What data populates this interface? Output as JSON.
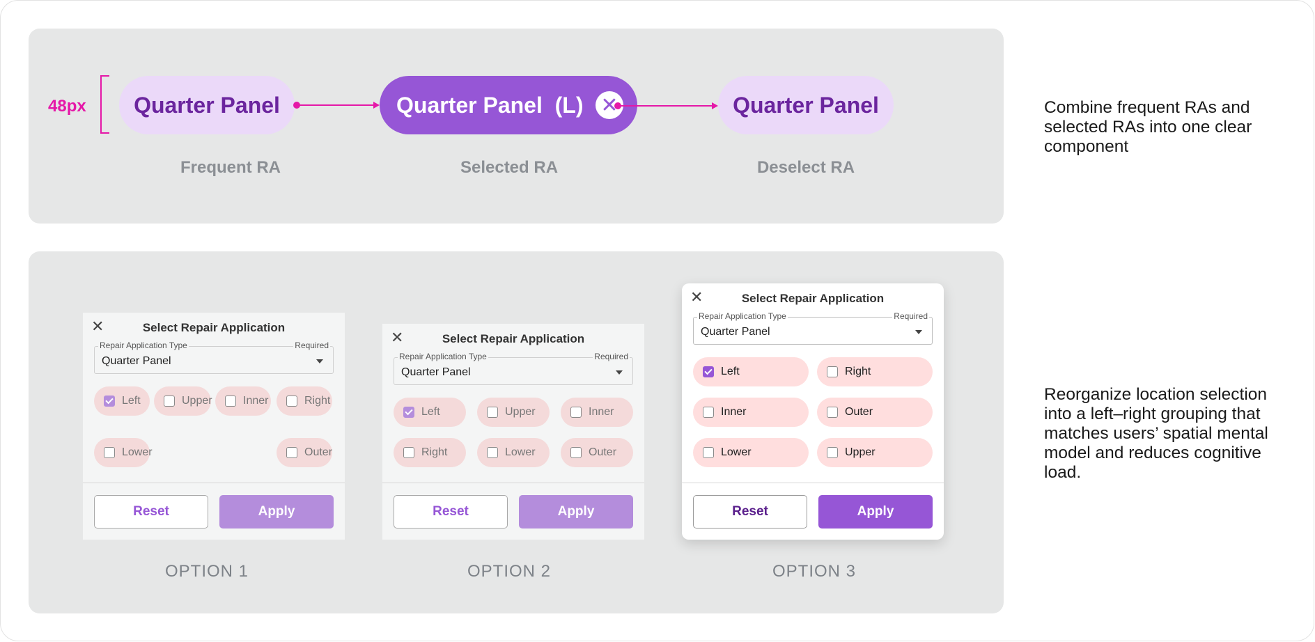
{
  "flow": {
    "height_marker": "48px",
    "chips": [
      {
        "label": "Quarter Panel",
        "caption": "Frequent RA"
      },
      {
        "label": "Quarter Panel  (L)",
        "caption": "Selected RA",
        "close_glyph": "✕"
      },
      {
        "label": "Quarter Panel",
        "caption": "Deselect RA"
      }
    ],
    "accent_color": "#e518a8",
    "chip_selected_color": "#9656d6",
    "chip_frequent_color": "#ebd9f9"
  },
  "notes": {
    "top": "Combine frequent RAs and selected RAs into one clear component",
    "bottom": "Reorganize location selection into a left–right grouping that matches users’ spatial mental model and reduces cognitive load."
  },
  "dialogs": [
    {
      "option_label": "OPTION 1",
      "title": "Select Repair Application",
      "field_label": "Repair Application Type",
      "field_required": "Required",
      "field_value": "Quarter Panel",
      "options": [
        {
          "label": "Left",
          "checked": true
        },
        {
          "label": "Upper",
          "checked": false
        },
        {
          "label": "Inner",
          "checked": false
        },
        {
          "label": "Right",
          "checked": false
        },
        {
          "label": "Lower",
          "checked": false
        },
        {
          "label": "Outer",
          "checked": false
        }
      ],
      "reset_label": "Reset",
      "apply_label": "Apply"
    },
    {
      "option_label": "OPTION 2",
      "title": "Select Repair Application",
      "field_label": "Repair Application Type",
      "field_required": "Required",
      "field_value": "Quarter Panel",
      "options": [
        {
          "label": "Left",
          "checked": true
        },
        {
          "label": "Upper",
          "checked": false
        },
        {
          "label": "Inner",
          "checked": false
        },
        {
          "label": "Right",
          "checked": false
        },
        {
          "label": "Lower",
          "checked": false
        },
        {
          "label": "Outer",
          "checked": false
        }
      ],
      "reset_label": "Reset",
      "apply_label": "Apply"
    },
    {
      "option_label": "OPTION 3",
      "title": "Select Repair Application",
      "field_label": "Repair Application Type",
      "field_required": "Required",
      "field_value": "Quarter Panel",
      "options": [
        {
          "label": "Left",
          "checked": true
        },
        {
          "label": "Right",
          "checked": false
        },
        {
          "label": "Inner",
          "checked": false
        },
        {
          "label": "Outer",
          "checked": false
        },
        {
          "label": "Lower",
          "checked": false
        },
        {
          "label": "Upper",
          "checked": false
        }
      ],
      "reset_label": "Reset",
      "apply_label": "Apply"
    }
  ]
}
